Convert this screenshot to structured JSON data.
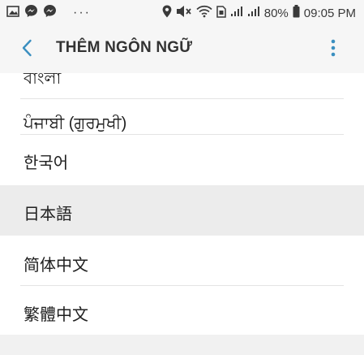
{
  "status_bar": {
    "left_icons": [
      "gallery-icon",
      "messenger-icon",
      "messenger-icon"
    ],
    "more_notifications": "···",
    "battery_percent": "80%",
    "time": "09:05 PM",
    "right_icons": [
      "location-icon",
      "mute-icon",
      "wifi-icon",
      "sim-icon",
      "signal-icon",
      "signal-icon",
      "battery-icon"
    ]
  },
  "app_bar": {
    "title": "THÊM NGÔN NGỮ",
    "back_icon": "chevron-left-icon",
    "menu_icon": "more-vertical-icon",
    "accent_color": "#3b8fc0"
  },
  "languages": [
    {
      "label": "বাংলা",
      "selected": false
    },
    {
      "label": "ਪੰਜਾਬੀ (ਗੁਰਮੁਖੀ)",
      "selected": false
    },
    {
      "label": "한국어",
      "selected": false
    },
    {
      "label": "日本語",
      "selected": true
    },
    {
      "label": "简体中文",
      "selected": false
    },
    {
      "label": "繁體中文",
      "selected": false
    }
  ]
}
